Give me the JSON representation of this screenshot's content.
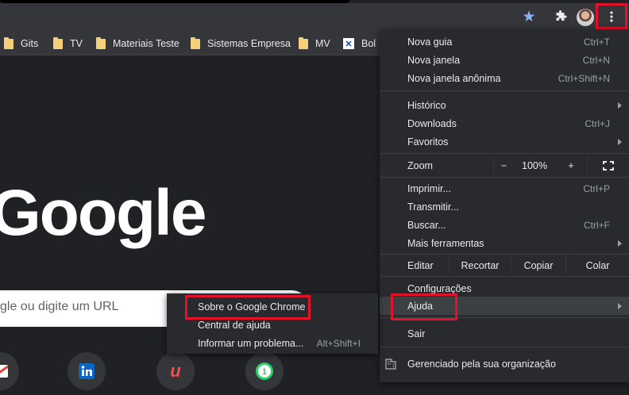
{
  "bookmarks": {
    "items": [
      {
        "label": "Gits"
      },
      {
        "label": "TV"
      },
      {
        "label": "Materiais Teste"
      },
      {
        "label": "Sistemas Empresa"
      },
      {
        "label": "MV"
      },
      {
        "label": "Bol"
      }
    ]
  },
  "page": {
    "logo_text": "Google",
    "search_placeholder": "gle ou digite um URL"
  },
  "menu": {
    "nova_guia": "Nova guia",
    "nova_guia_acc": "Ctrl+T",
    "nova_janela": "Nova janela",
    "nova_janela_acc": "Ctrl+N",
    "anonima": "Nova janela anônima",
    "anonima_acc": "Ctrl+Shift+N",
    "historico": "Histórico",
    "downloads": "Downloads",
    "downloads_acc": "Ctrl+J",
    "favoritos": "Favoritos",
    "zoom": "Zoom",
    "zoom_minus": "−",
    "zoom_value": "100%",
    "zoom_plus": "+",
    "imprimir": "Imprimir...",
    "imprimir_acc": "Ctrl+P",
    "transmitir": "Transmitir...",
    "buscar": "Buscar...",
    "buscar_acc": "Ctrl+F",
    "mais_ferramentas": "Mais ferramentas",
    "editar": "Editar",
    "recortar": "Recortar",
    "copiar": "Copiar",
    "colar": "Colar",
    "configuracoes": "Configurações",
    "ajuda": "Ajuda",
    "sair": "Sair",
    "gerenciado": "Gerenciado pela sua organização"
  },
  "submenu": {
    "sobre": "Sobre o Google Chrome",
    "central": "Central de ajuda",
    "informar": "Informar um problema...",
    "informar_acc": "Alt+Shift+I"
  },
  "colors": {
    "highlight_box": "#e5102a",
    "star": "#8ab4f8"
  }
}
